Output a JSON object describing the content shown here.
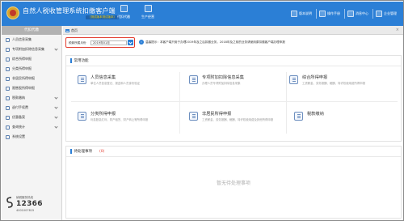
{
  "header": {
    "app_title": "自然人税收管理系统扣缴客户端",
    "app_version": "（测试版本测试版本）",
    "tools": [
      {
        "label": "代扣代缴"
      },
      {
        "label": "生产经营"
      }
    ],
    "links": [
      {
        "label": "版本说明"
      },
      {
        "label": "操作手册"
      },
      {
        "label": "消息中心"
      },
      {
        "label": "企业管理"
      }
    ]
  },
  "sidebar": {
    "heading": "代扣代缴",
    "items": [
      {
        "label": "人员信息采集",
        "expandable": false
      },
      {
        "label": "专项附加扣除信息采集",
        "expandable": true
      },
      {
        "label": "综合所得申报",
        "expandable": false
      },
      {
        "label": "分类所得申报",
        "expandable": false
      },
      {
        "label": "非居民所得申报",
        "expandable": false
      },
      {
        "label": "限售股所得申报",
        "expandable": false
      },
      {
        "label": "税款缴纳",
        "expandable": true
      },
      {
        "label": "退付手续费",
        "expandable": true
      },
      {
        "label": "优惠备案",
        "expandable": true
      },
      {
        "label": "查询统计",
        "expandable": true
      },
      {
        "label": "系统设置",
        "expandable": false
      }
    ],
    "hotline": {
      "label": "纳税服务热线",
      "number": "12366",
      "number2": "4001007815"
    }
  },
  "main": {
    "tab": {
      "label": "首页",
      "close": "×"
    },
    "period": {
      "label": "税款所属月份",
      "value": "2019年01月"
    },
    "tip": {
      "icon": "i",
      "text": "温馨提示：本客户端只用于办理2019年及之后扣缴业务，2018年及之前的业务请使用原扣缴客户端办理申报"
    },
    "common_functions": {
      "title": "常用功能",
      "cards": [
        {
          "title": "人员信息采集",
          "desc": "单位人员信息登记、报送和人员身份验证"
        },
        {
          "title": "专项附加扣除信息采集",
          "desc": "办理人员专项附加扣除信息采集"
        },
        {
          "title": "综合所得申报",
          "desc": "工资薪金、劳务报酬、稿酬、特许权使用费所得申报"
        },
        {
          "title": "分类所得申报",
          "desc": "利息股息红利、财产租赁、财产转让等所得申报"
        },
        {
          "title": "非居民所得申报",
          "desc": "工资薪金、劳务报酬、稿酬、特许权使用费及其他所得申报"
        },
        {
          "title": "税款缴纳",
          "desc": ""
        }
      ]
    },
    "pending": {
      "title": "待处理事项",
      "count": "(0)",
      "empty_text": "暂无待处理事项"
    }
  }
}
